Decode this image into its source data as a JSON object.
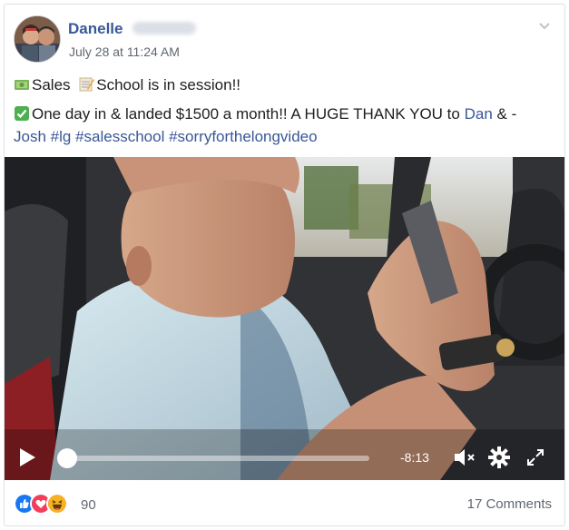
{
  "post": {
    "author": "Danelle",
    "timestamp": "July 28 at 11:24 AM",
    "line1": {
      "w1": "Sales",
      "w2": "School is in session!!"
    },
    "line2": {
      "part1": "One day in & landed $1500 a month!! A HUGE THANK YOU to ",
      "link_dan": "Dan",
      "part2": " & -",
      "link_josh": "Josh",
      "hashtags": [
        "#lg",
        "#salesschool",
        "#sorryforthelongvideo"
      ]
    }
  },
  "video": {
    "time_remaining": "-8:13",
    "progress": 0.01
  },
  "footer": {
    "reaction_count": "90",
    "comments": "17 Comments"
  },
  "icons": {
    "money": "money-emoji",
    "memo": "memo-emoji",
    "check": "check-emoji",
    "reactions": [
      "like-icon",
      "love-icon",
      "haha-icon"
    ]
  },
  "colors": {
    "link": "#385898",
    "like": "#1877f2",
    "love": "#f33e58",
    "haha": "#f7b125",
    "check": "#4caf50"
  }
}
